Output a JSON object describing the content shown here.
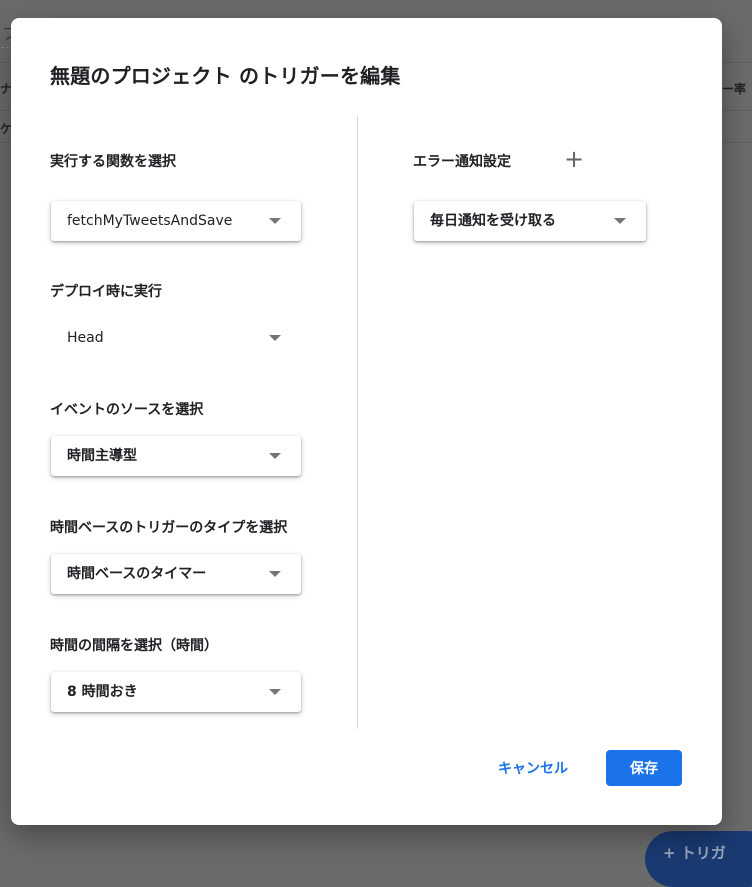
{
  "background": {
    "top_field_text": "プ",
    "left_header_fragment": "ナ",
    "right_header_fragment": "ー率",
    "row_fragment": "ケ",
    "fab_label": "+ トリガ"
  },
  "dialog": {
    "title": "無題のプロジェクト のトリガーを編集",
    "function_select": {
      "label": "実行する関数を選択",
      "value": "fetchMyTweetsAndSave"
    },
    "deployment_select": {
      "label": "デプロイ時に実行",
      "value": "Head"
    },
    "event_source_select": {
      "label": "イベントのソースを選択",
      "value": "時間主導型"
    },
    "time_trigger_type_select": {
      "label": "時間ベースのトリガーのタイプを選択",
      "value": "時間ベースのタイマー"
    },
    "interval_select": {
      "label": "時間の間隔を選択（時間）",
      "value": "8 時間おき"
    },
    "error_notification": {
      "label": "エラー通知設定",
      "add_icon": "plus-icon",
      "value": "毎日通知を受け取る"
    },
    "cancel_label": "キャンセル",
    "save_label": "保存"
  },
  "colors": {
    "accent": "#1a73e8",
    "overlay": "#6b6b6b"
  }
}
